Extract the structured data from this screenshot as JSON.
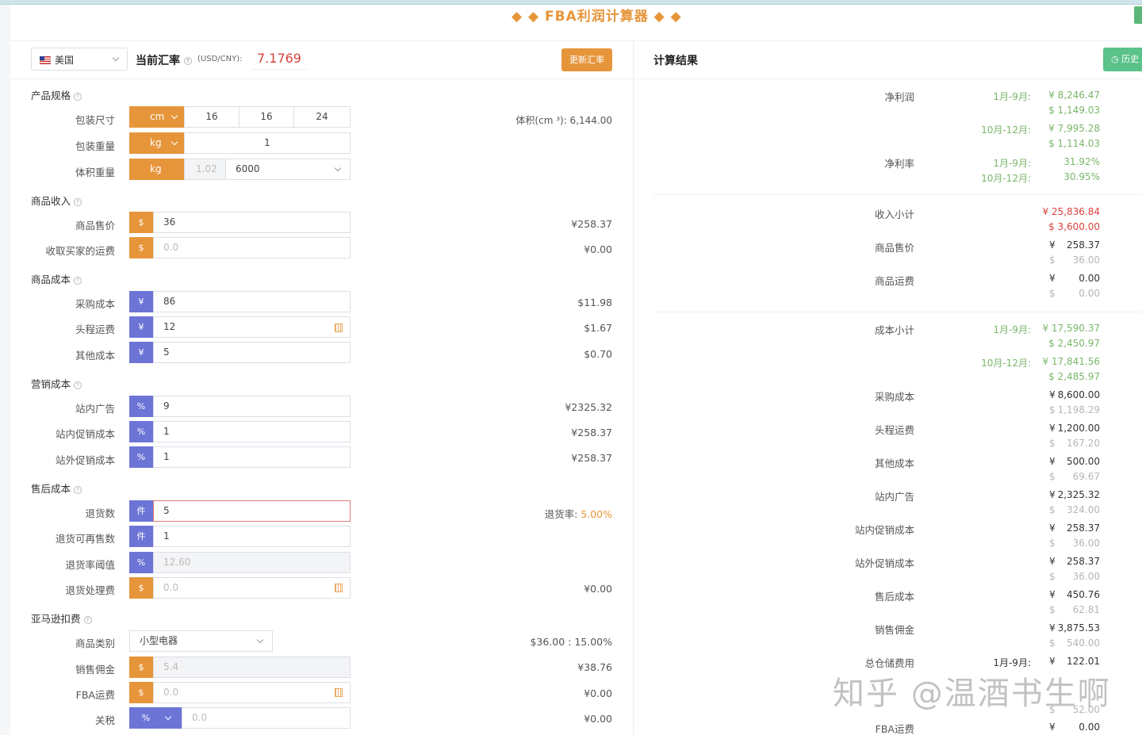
{
  "app_title": "◆ ◆  FBA利润计算器  ◆ ◆",
  "rate_bar": {
    "country": "美国",
    "title": "当前汇率",
    "unit": "(USD/CNY):",
    "rate": "7.1769",
    "update_button": "更新汇率"
  },
  "spec": {
    "title": "产品规格",
    "size_label": "包装尺寸",
    "size_unit": "cm",
    "size_l": "16",
    "size_w": "16",
    "size_h": "24",
    "volume_text": "体积(cm ³): 6,144.00",
    "weight_label": "包装重量",
    "weight_unit": "kg",
    "weight": "1",
    "volw_label": "体积重量",
    "volw_unit": "kg",
    "volw_value": "1.02",
    "volw_divisor": "6000"
  },
  "income": {
    "title": "商品收入",
    "price_label": "商品售价",
    "price_cur": "$",
    "price": "36",
    "price_cny": "¥258.37",
    "ship_label": "收取买家的运费",
    "ship_cur": "$",
    "ship_ph": "0.0",
    "ship_cny": "¥0.00"
  },
  "cost": {
    "title": "商品成本",
    "purchase_label": "采购成本",
    "purchase_cur": "¥",
    "purchase": "86",
    "purchase_usd": "$11.98",
    "freight_label": "头程运费",
    "freight_cur": "¥",
    "freight": "12",
    "freight_usd": "$1.67",
    "other_label": "其他成本",
    "other_cur": "¥",
    "other": "5",
    "other_usd": "$0.70"
  },
  "marketing": {
    "title": "营销成本",
    "ads_label": "站内广告",
    "ads_cur": "%",
    "ads": "9",
    "ads_cny": "¥2325.32",
    "promo_label": "站内促销成本",
    "promo_cur": "%",
    "promo": "1",
    "promo_cny": "¥258.37",
    "ext_label": "站外促销成本",
    "ext_cur": "%",
    "ext": "1",
    "ext_cny": "¥258.37"
  },
  "aftersale": {
    "title": "售后成本",
    "returns_label": "退货数",
    "returns_cur": "件",
    "returns": "5",
    "returns_rate_label": "退货率:",
    "returns_rate": "5.00%",
    "resell_label": "退货可再售数",
    "resell_cur": "件",
    "resell": "1",
    "threshold_label": "退货率阈值",
    "threshold_cur": "%",
    "threshold_ph": "12.60",
    "handling_label": "退货处理费",
    "handling_cur": "$",
    "handling_ph": "0.0",
    "handling_cny": "¥0.00"
  },
  "amazon": {
    "title": "亚马逊扣费",
    "category_label": "商品类别",
    "category": "小型电器",
    "category_info": "$36.00 : 15.00%",
    "commission_label": "销售佣金",
    "commission_cur": "$",
    "commission_ph": "5.4",
    "commission_cny": "¥38.76",
    "fba_label": "FBA运费",
    "fba_cur": "$",
    "fba_ph": "0.0",
    "fba_cny": "¥0.00",
    "tariff_label": "关税",
    "tariff_cur": "%",
    "tariff_ph": "0.0",
    "tariff_cny": "¥0.00"
  },
  "results": {
    "header": "计算结果",
    "history_button": "历史",
    "net_profit_label": "净利润",
    "np_p1": "1月-9月:",
    "np_p1_cny": "¥  8,246.47",
    "np_p1_usd": "$  1,149.03",
    "np_p2": "10月-12月:",
    "np_p2_cny": "¥  7,995.28",
    "np_p2_usd": "$  1,114.03",
    "margin_label": "净利率",
    "m_p1": "1月-9月:",
    "m_p1_val": "31.92%",
    "m_p2": "10月-12月:",
    "m_p2_val": "30.95%",
    "income_label": "收入小计",
    "income_cny": "¥  25,836.84",
    "income_usd": "$  3,600.00",
    "price_label": "商品售价",
    "price_cny": "258.37",
    "price_usd": "36.00",
    "ship_label": "商品运费",
    "ship_cny": "0.00",
    "ship_usd": "0.00",
    "cost_label": "成本小计",
    "c_p1": "1月-9月:",
    "c_p1_cny": "¥  17,590.37",
    "c_p1_usd": "$  2,450.97",
    "c_p2": "10月-12月:",
    "c_p2_cny": "¥  17,841.56",
    "c_p2_usd": "$  2,485.97",
    "purchase_label": "采购成本",
    "purchase_cny": "8,600.00",
    "purchase_usd": "1,198.29",
    "freight_label": "头程运费",
    "freight_cny": "1,200.00",
    "freight_usd": "167.20",
    "other_label": "其他成本",
    "other_cny": "500.00",
    "other_usd": "69.67",
    "ads_label": "站内广告",
    "ads_cny": "2,325.32",
    "ads_usd": "324.00",
    "promo_label": "站内促销成本",
    "promo_cny": "258.37",
    "promo_usd": "36.00",
    "ext_label": "站外促销成本",
    "ext_cny": "258.37",
    "ext_usd": "36.00",
    "aftersale_label": "售后成本",
    "aftersale_cny": "450.76",
    "aftersale_usd": "62.81",
    "commission_label": "销售佣金",
    "commission_cny": "3,875.53",
    "commission_usd": "540.00",
    "storage_label": "总仓储费用",
    "st_p1": "1月-9月:",
    "st_p1_cny": "122.01",
    "st_p2_usd": "52.00",
    "fba_label": "FBA运费",
    "fba_cny": "0.00",
    "yen": "¥",
    "dollar": "$"
  },
  "watermark": "知乎 @温酒书生啊"
}
